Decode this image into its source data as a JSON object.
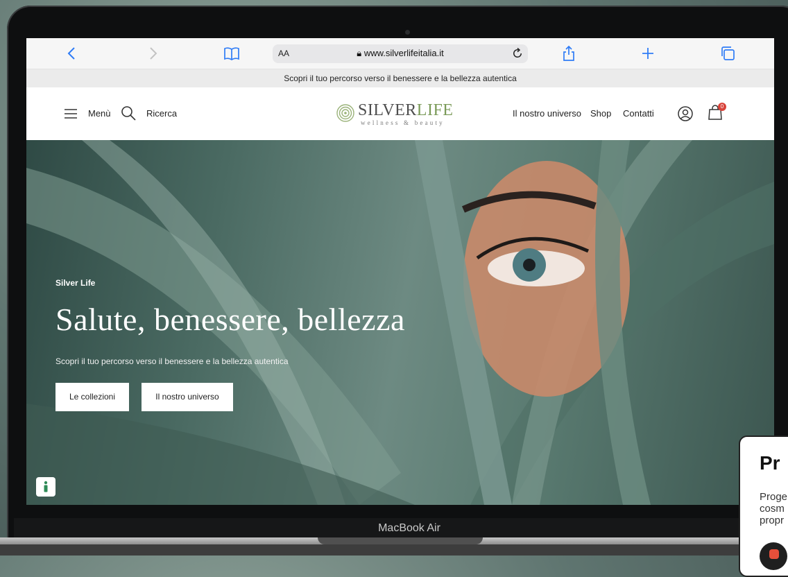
{
  "browser": {
    "url": "www.silverlifeitalia.it",
    "text_size_label": "AA"
  },
  "announcement": "Scopri il tuo percorso verso il benessere e la bellezza autentica",
  "header": {
    "menu_label": "Menù",
    "search_label": "Ricerca",
    "logo": {
      "name_part1": "SILVER",
      "name_part2": "LIFE",
      "tagline": "wellness & beauty"
    },
    "nav": [
      {
        "label": "Il nostro universo"
      },
      {
        "label": "Shop"
      },
      {
        "label": "Contatti"
      }
    ],
    "cart_count": "0"
  },
  "hero": {
    "eyebrow": "Silver Life",
    "title": "Salute, benessere, bellezza",
    "subtitle": "Scopri il tuo percorso verso il benessere e la bellezza autentica",
    "buttons": [
      {
        "label": "Le collezioni"
      },
      {
        "label": "Il nostro universo"
      }
    ]
  },
  "device_label": "MacBook Air",
  "popup": {
    "title": "Pr",
    "text_lines": [
      "Proge",
      "cosm",
      "propr"
    ]
  },
  "colors": {
    "accent_green": "#7a9a58",
    "safari_blue": "#2f7cf6",
    "badge_red": "#d8433a"
  }
}
